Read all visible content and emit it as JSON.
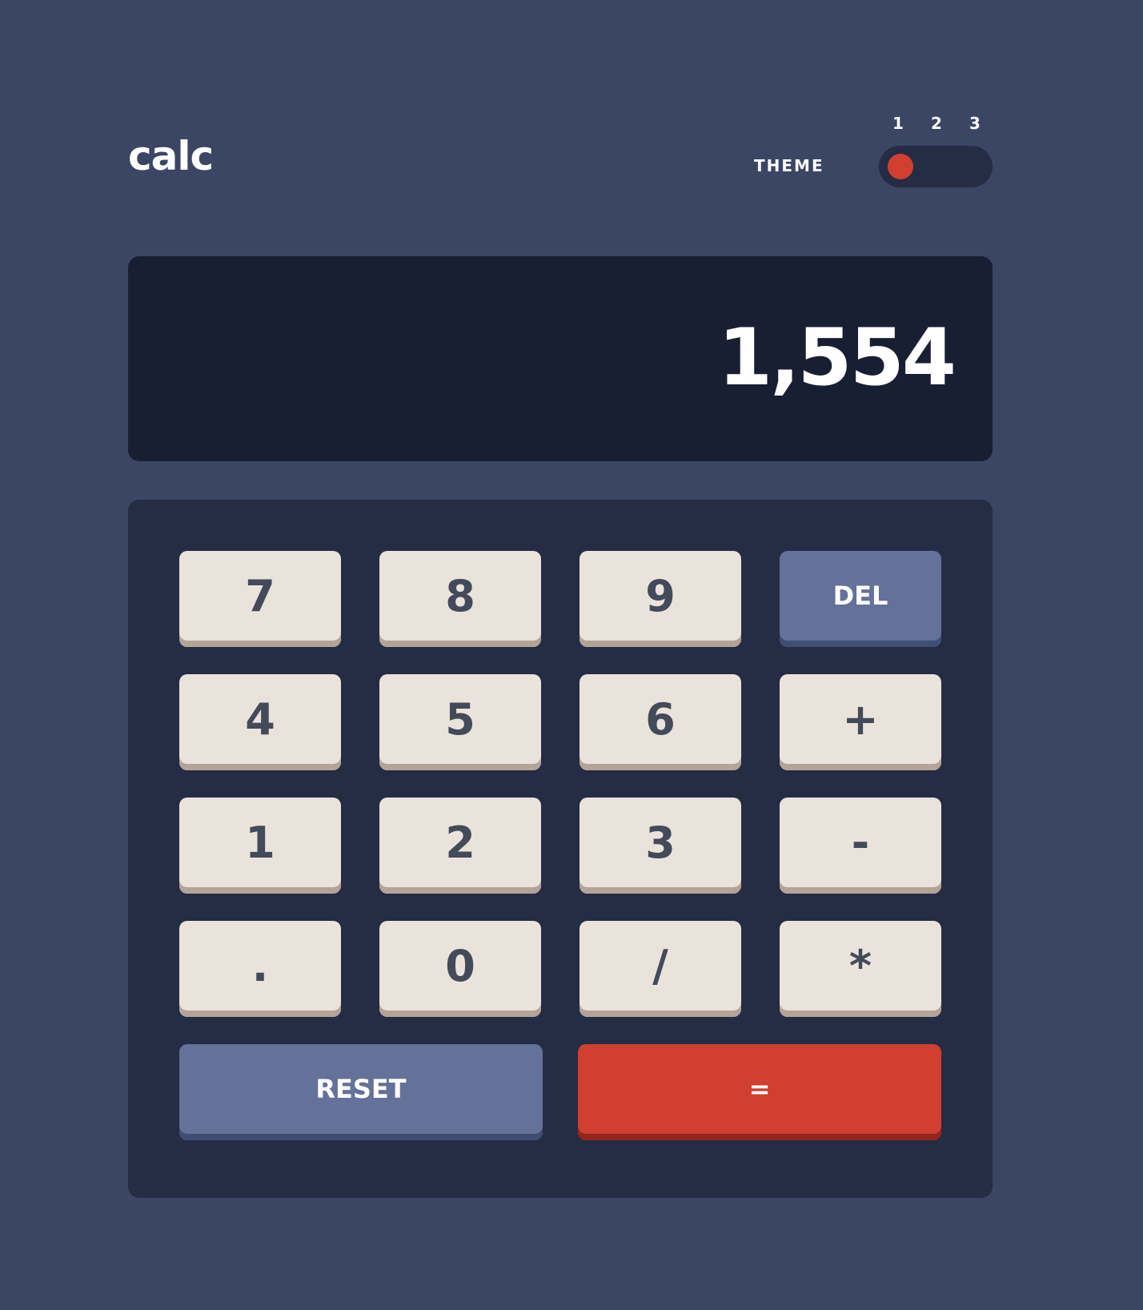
{
  "header": {
    "logo": "calc",
    "theme_label": "THEME",
    "theme_options": [
      "1",
      "2",
      "3"
    ],
    "theme_selected": "1"
  },
  "display": {
    "value": "1,554"
  },
  "keypad": {
    "rows": [
      [
        "7",
        "8",
        "9",
        "DEL"
      ],
      [
        "4",
        "5",
        "6",
        "+"
      ],
      [
        "1",
        "2",
        "3",
        "-"
      ],
      [
        ".",
        "0",
        "/",
        "*"
      ]
    ],
    "reset_label": "RESET",
    "equals_label": "="
  },
  "colors": {
    "background": "#3b4664",
    "screen": "#181f33",
    "keypad": "#252d44",
    "key": "#eae3dc",
    "key_shadow": "#b3a497",
    "key_text": "#434a59",
    "accent_blue": "#647198",
    "accent_red": "#d03f2f"
  }
}
